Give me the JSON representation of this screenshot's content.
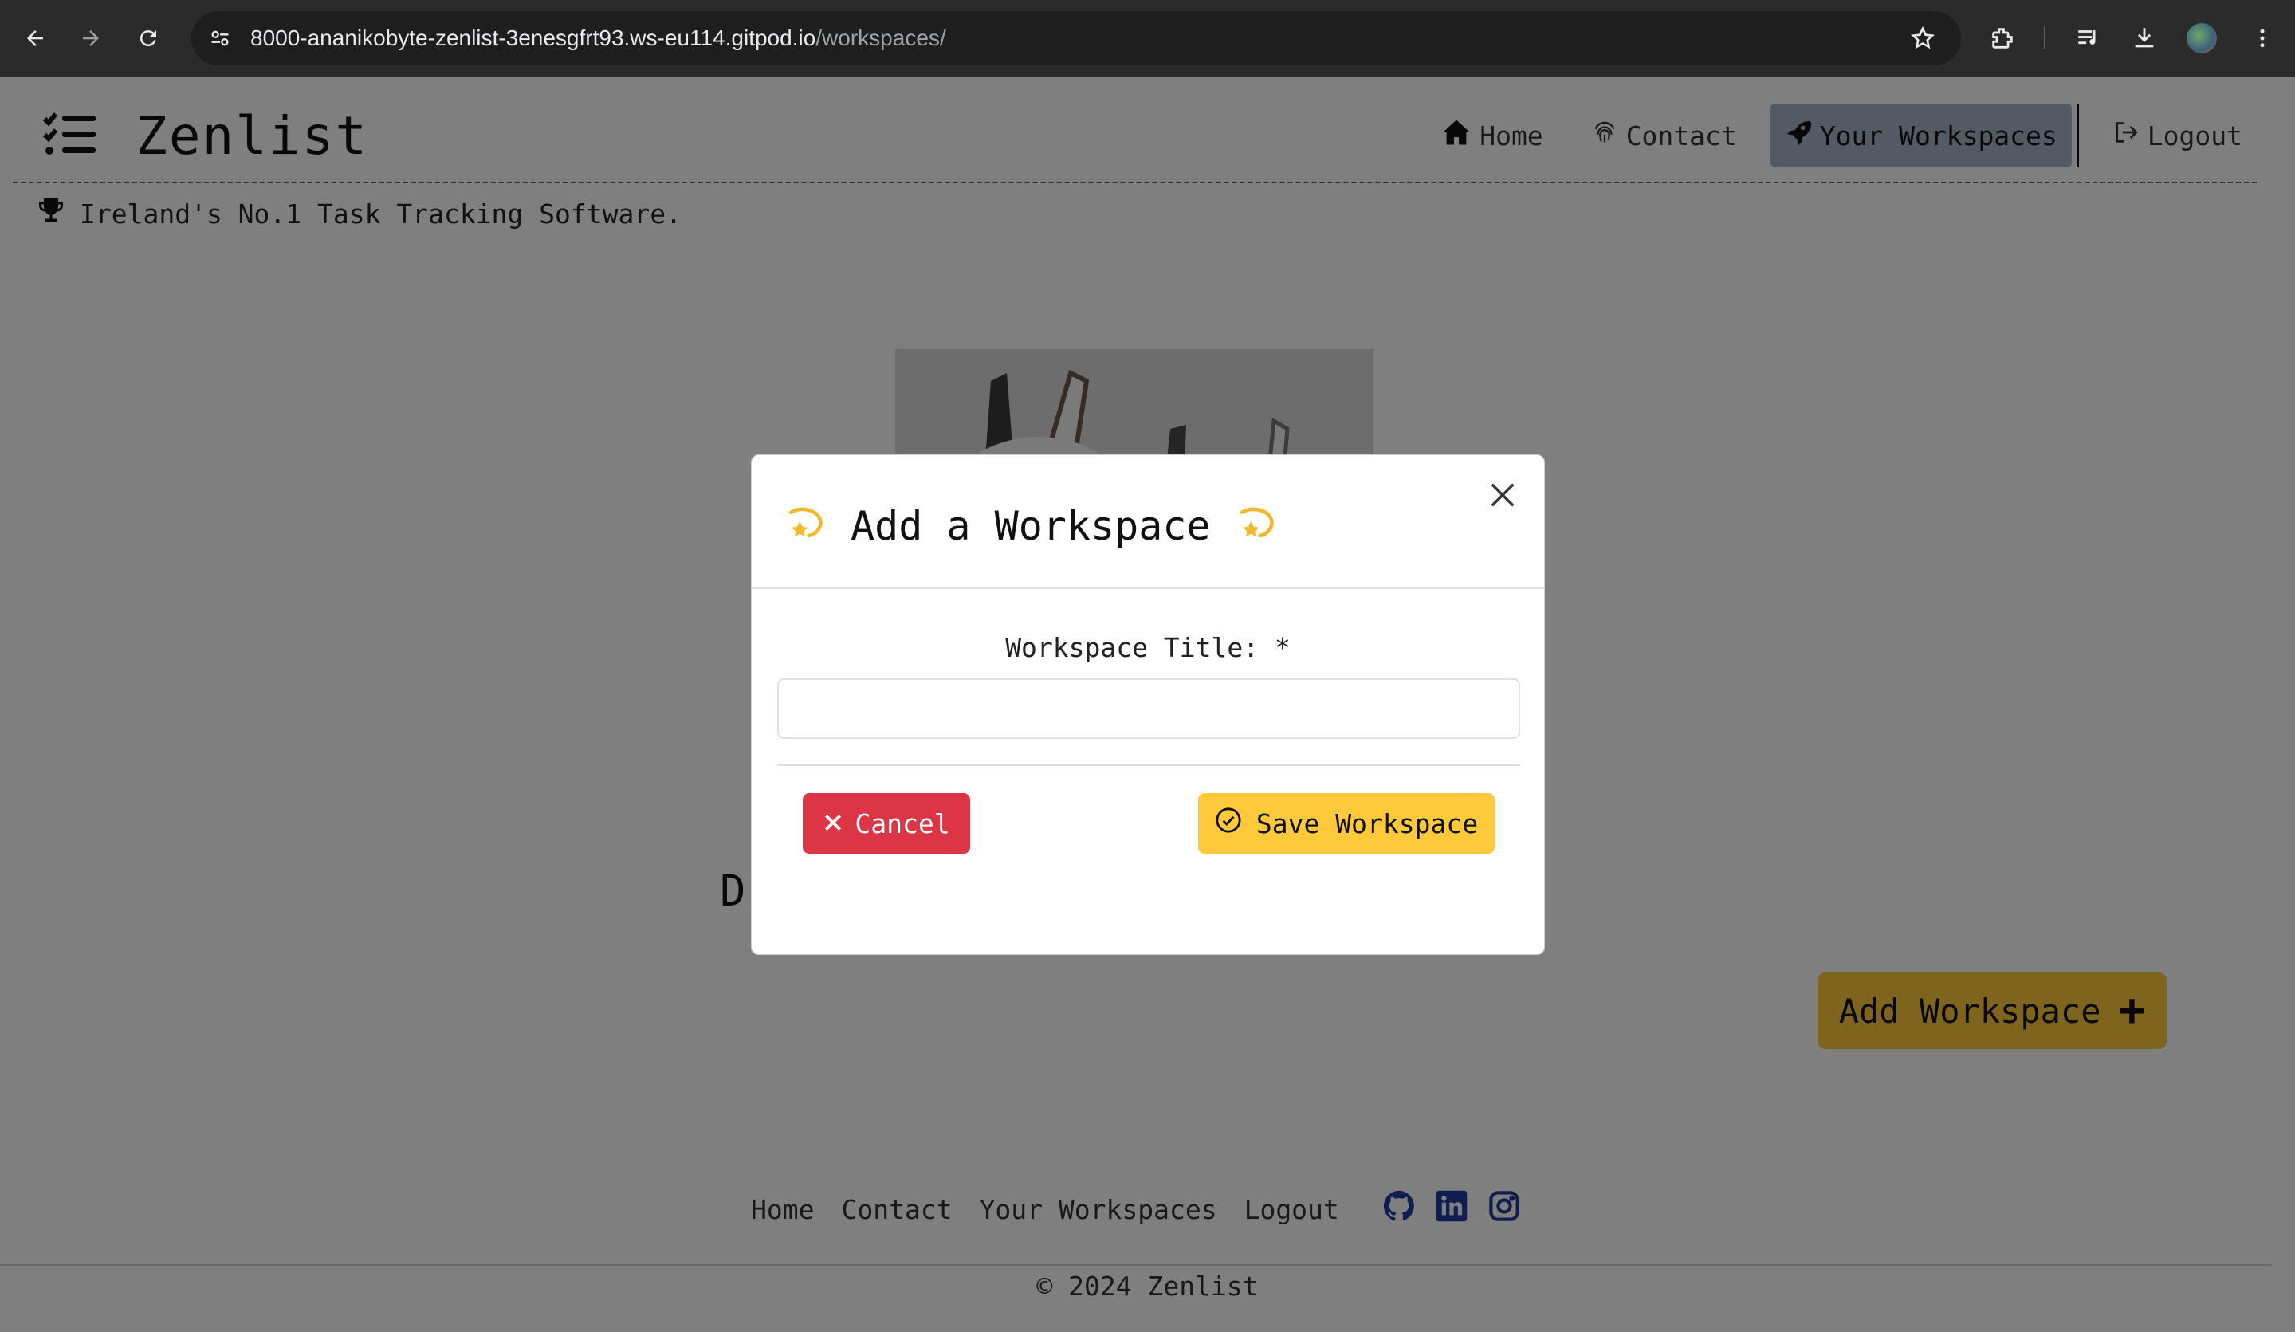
{
  "browser": {
    "url_host": "8000-ananikobyte-zenlist-3enesgfrt93.ws-eu114.gitpod.io",
    "url_path": "/workspaces/"
  },
  "navbar": {
    "brand": "Zenlist",
    "links": [
      {
        "label": "Home",
        "icon": "home-icon"
      },
      {
        "label": "Contact",
        "icon": "fingerprint-icon"
      },
      {
        "label": "Your Workspaces",
        "icon": "rocket-icon",
        "active": true
      },
      {
        "label": "Logout",
        "icon": "logout-icon"
      }
    ]
  },
  "tagline": "Ireland's No.1 Task Tracking Software.",
  "main": {
    "heading_fragment": "D",
    "add_workspace_label": "Add Workspace"
  },
  "modal": {
    "title": "Add a Workspace",
    "field_label": "Workspace Title: *",
    "field_value": "",
    "cancel_label": "Cancel",
    "save_label": "Save Workspace"
  },
  "footer": {
    "links": [
      "Home",
      "Contact",
      "Your Workspaces",
      "Logout"
    ],
    "social": [
      "github-icon",
      "linkedin-icon",
      "instagram-icon"
    ],
    "copyright": "© 2024 Zenlist"
  },
  "colors": {
    "accent_yellow": "#ffc93c",
    "danger_red": "#dc3545",
    "active_nav": "#a5b4c6",
    "social_blue": "#1f3aa0"
  }
}
